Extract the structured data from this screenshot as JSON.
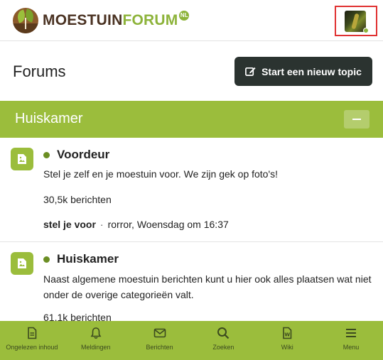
{
  "brand": {
    "name_part1": "MOESTUIN",
    "name_part2": "FORUM",
    "badge": "NL"
  },
  "page": {
    "title": "Forums",
    "new_topic_label": "Start een nieuw topic"
  },
  "category": {
    "title": "Huiskamer"
  },
  "forums": [
    {
      "name": "Voordeur",
      "description": "Stel je zelf en je moestuin voor. We zijn gek op foto's!",
      "count": "30,5k berichten",
      "last_topic": "stel je voor",
      "separator": "·",
      "last_meta": "rorror, Woensdag om 16:37"
    },
    {
      "name": "Huiskamer",
      "description": "Naast algemene moestuin berichten kunt u hier ook alles plaatsen wat niet onder de overige categorieën valt.",
      "count": "61,1k berichten"
    }
  ],
  "bottom_nav": [
    {
      "label": "Ongelezen inhoud",
      "icon": "document-icon"
    },
    {
      "label": "Meldingen",
      "icon": "bell-icon"
    },
    {
      "label": "Berichten",
      "icon": "envelope-icon"
    },
    {
      "label": "Zoeken",
      "icon": "search-icon"
    },
    {
      "label": "Wiki",
      "icon": "wiki-icon"
    },
    {
      "label": "Menu",
      "icon": "hamburger-icon"
    }
  ],
  "colors": {
    "accent": "#9bbd3c",
    "dark_button": "#2b3330",
    "brand_brown": "#4a3222",
    "highlight_border": "#e03131"
  }
}
